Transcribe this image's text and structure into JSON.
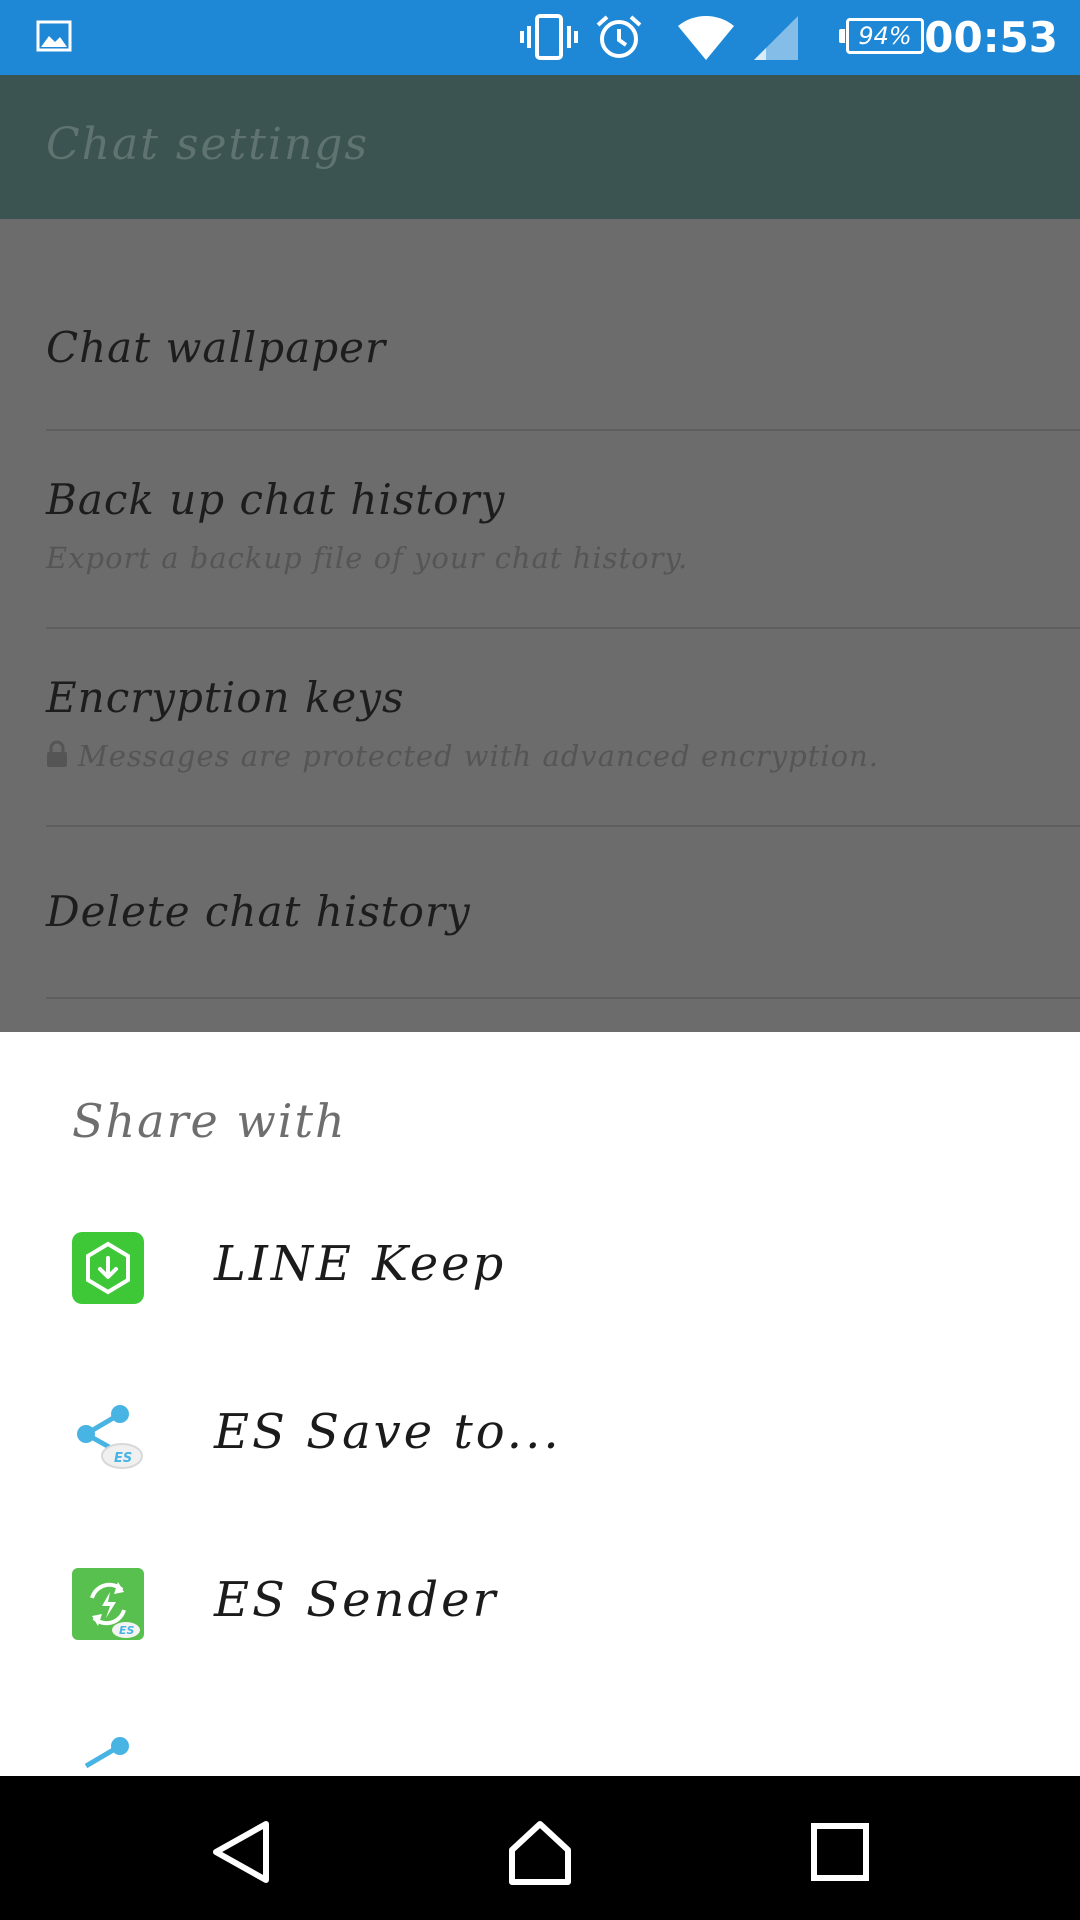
{
  "status_bar": {
    "time": "00:53",
    "battery": "94%",
    "icons": [
      "image-notification-icon",
      "vibrate-icon",
      "alarm-icon",
      "wifi-icon",
      "cell-signal-icon",
      "battery-icon"
    ]
  },
  "background_app": {
    "title": "Chat settings",
    "items": [
      {
        "label": "Chat wallpaper"
      },
      {
        "label": "Back up chat history",
        "sub": "Export a backup file of your chat history."
      },
      {
        "label": "Encryption keys",
        "sub": "Messages are protected with advanced encryption.",
        "sub_icon": "lock-icon"
      },
      {
        "label": "Delete chat history"
      }
    ]
  },
  "share_sheet": {
    "title": "Share with",
    "items": [
      {
        "label": "LINE Keep",
        "icon": "line-keep-icon",
        "color": "#3ec838"
      },
      {
        "label": "ES Save to...",
        "icon": "es-share-icon",
        "color": "#48b4e4"
      },
      {
        "label": "ES Sender",
        "icon": "es-sender-icon",
        "color": "#58c04e"
      }
    ]
  },
  "colors": {
    "status_bar": "#1e88d6",
    "app_bar_dimmed": "#3c5451",
    "list_dimmed": "#6c6c6c",
    "nav_bar": "#000000"
  },
  "nav_bar": {
    "buttons": [
      "back-icon",
      "home-icon",
      "recents-icon"
    ]
  }
}
